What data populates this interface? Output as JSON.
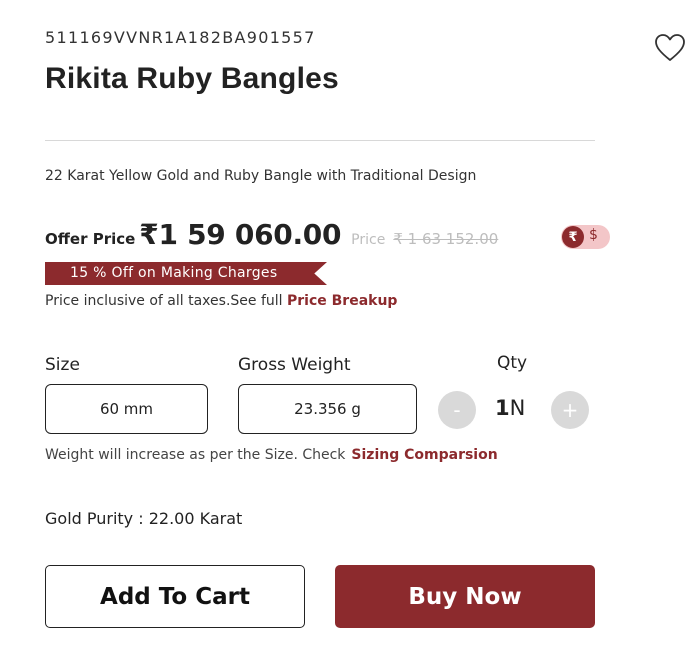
{
  "product": {
    "sku": "511169VVNR1A182BA901557",
    "title": "Rikita Ruby Bangles",
    "description": "22 Karat Yellow Gold and Ruby Bangle with Traditional Design"
  },
  "pricing": {
    "offer_label": "Offer Price",
    "offer_price": "₹1 59 060.00",
    "mrp_label": "Price",
    "mrp_value": "₹ 1 63 152.00",
    "discount_ribbon": "15 % Off on Making Charges",
    "tax_note": "Price inclusive of all taxes.See full ",
    "price_breakup_link": "Price Breakup"
  },
  "currency_toggle": {
    "rupee": "₹",
    "dollar": "$",
    "selected": "₹",
    "active_color": "#8c2a2d",
    "track_color": "#f3c6c8"
  },
  "options": {
    "size_label": "Size",
    "size_value": "60 mm",
    "gross_weight_label": "Gross Weight",
    "gross_weight_value": "23.356 g",
    "qty_label": "Qty",
    "qty_minus": "-",
    "qty_value": "1",
    "qty_unit": "N",
    "qty_plus": "+",
    "weight_note": "Weight will increase as per the Size. Check",
    "sizing_link": "Sizing Comparsion"
  },
  "purity": {
    "text": "Gold Purity : 22.00 Karat"
  },
  "actions": {
    "add_to_cart": "Add To Cart",
    "buy_now": "Buy Now"
  },
  "icons": {
    "wishlist": "heart-icon"
  },
  "colors": {
    "brand": "#8c2a2d",
    "muted": "#bdbdbd",
    "qty_button": "#d9d9d9"
  }
}
